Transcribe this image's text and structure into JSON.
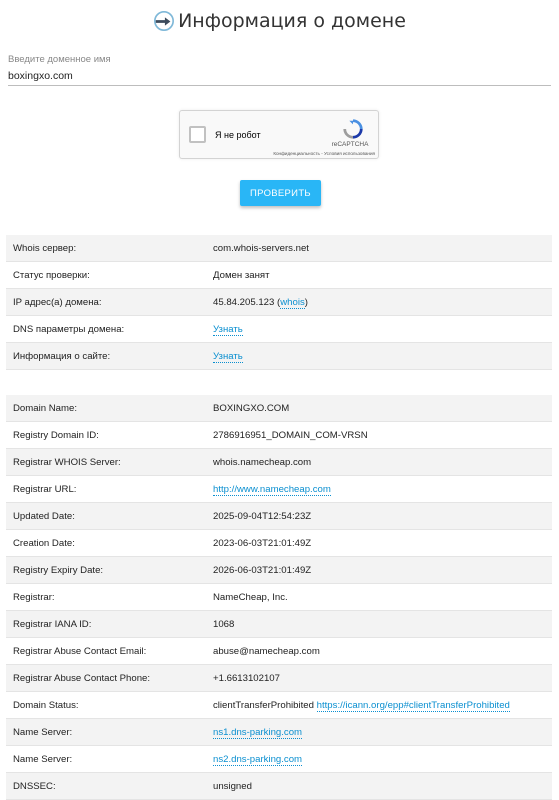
{
  "page": {
    "title": "Информация о домене",
    "colors": {
      "accent": "#29b6f6",
      "link": "#0a8fd0"
    }
  },
  "form": {
    "domain_label": "Введите доменное имя",
    "domain_value": "boxingxo.com",
    "captcha": {
      "label": "Я не робот",
      "brand": "reCAPTCHA",
      "links": "Конфиденциальность - Условия использования"
    },
    "check_button": "ПРОВЕРИТЬ"
  },
  "summary": {
    "whois_server_label": "Whois сервер:",
    "whois_server_value": "com.whois-servers.net",
    "status_label": "Статус проверки:",
    "status_value": "Домен занят",
    "ip_label": "IP адрес(а) домена:",
    "ip_value": "45.84.205.123",
    "ip_whois_link": "whois",
    "dns_label": "DNS параметры домена:",
    "dns_link": "Узнать",
    "site_label": "Информация о сайте:",
    "site_link": "Узнать"
  },
  "whois": {
    "domain_name_label": "Domain Name:",
    "domain_name_value": "BOXINGXO.COM",
    "registry_id_label": "Registry Domain ID:",
    "registry_id_value": "2786916951_DOMAIN_COM-VRSN",
    "registrar_whois_label": "Registrar WHOIS Server:",
    "registrar_whois_value": "whois.namecheap.com",
    "registrar_url_label": "Registrar URL:",
    "registrar_url_value": "http://www.namecheap.com",
    "updated_label": "Updated Date:",
    "updated_value": "2025-09-04T12:54:23Z",
    "creation_label": "Creation Date:",
    "creation_value": "2023-06-03T21:01:49Z",
    "expiry_label": "Registry Expiry Date:",
    "expiry_value": "2026-06-03T21:01:49Z",
    "registrar_label": "Registrar:",
    "registrar_value": "NameCheap, Inc.",
    "iana_label": "Registrar IANA ID:",
    "iana_value": "1068",
    "abuse_email_label": "Registrar Abuse Contact Email:",
    "abuse_email_value": "abuse@namecheap.com",
    "abuse_phone_label": "Registrar Abuse Contact Phone:",
    "abuse_phone_value": "+1.6613102107",
    "status_label": "Domain Status:",
    "status_value": "clientTransferProhibited",
    "status_link": "https://icann.org/epp#clientTransferProhibited",
    "ns1_label": "Name Server:",
    "ns1_value": "ns1.dns-parking.com",
    "ns2_label": "Name Server:",
    "ns2_value": "ns2.dns-parking.com",
    "dnssec_label": "DNSSEC:",
    "dnssec_value": "unsigned"
  }
}
